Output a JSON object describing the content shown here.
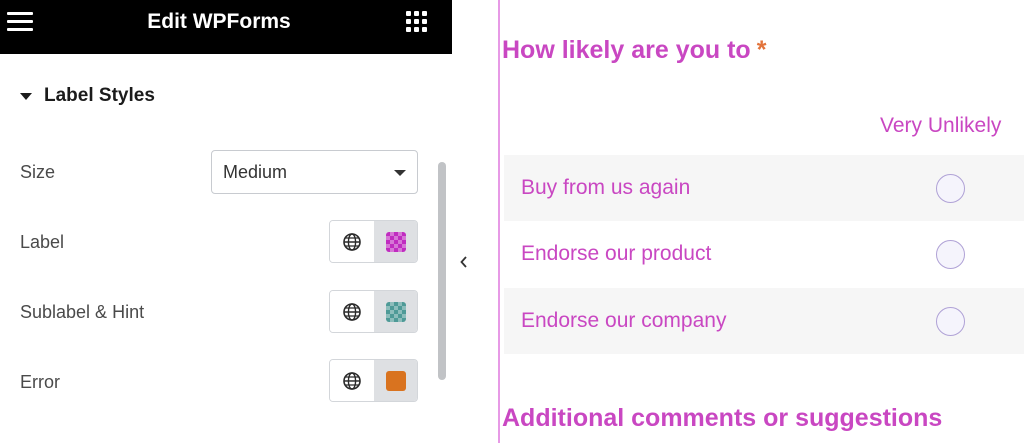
{
  "topbar": {
    "title": "Edit WPForms",
    "menu_icon": "hamburger-icon",
    "apps_icon": "grid-icon"
  },
  "section": {
    "title": "Label Styles",
    "expanded": true
  },
  "controls": {
    "size": {
      "label": "Size",
      "value": "Medium"
    },
    "label": {
      "label": "Label",
      "color": "#c02cc0"
    },
    "sublabel_hint": {
      "label": "Sublabel & Hint",
      "color": "#4e9a97"
    },
    "error": {
      "label": "Error",
      "color": "#d9731f"
    }
  },
  "preview": {
    "question1": {
      "title": "How likely are you to",
      "required_mark": "*"
    },
    "column_header": "Very Unlikely",
    "rows": [
      {
        "label": "Buy from us again"
      },
      {
        "label": "Endorse our product"
      },
      {
        "label": "Endorse our company"
      }
    ],
    "question2": {
      "title": "Additional comments or suggestions"
    }
  },
  "colors": {
    "form_accent": "#c947c2",
    "required": "#e2733b",
    "topbar": "#000000"
  }
}
